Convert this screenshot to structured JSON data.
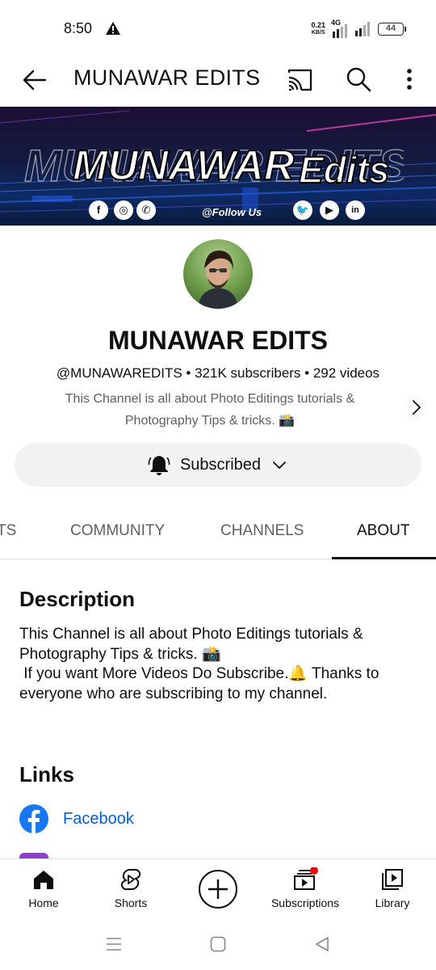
{
  "status_bar": {
    "time": "8:50",
    "net_speed_value": "0.21",
    "net_speed_unit": "KB/S",
    "network": "4G",
    "battery": "44"
  },
  "app_bar": {
    "title": "MUNAWAR EDITS"
  },
  "banner": {
    "follow_text": "@Follow Us"
  },
  "channel": {
    "name": "MUNAWAR EDITS",
    "meta": "@MUNAWAREDITS • 321K subscribers • 292 videos",
    "tagline": "This Channel is all about Photo Editings tutorials & Photography Tips & tricks. 📸"
  },
  "subscribe": {
    "label": "Subscribed"
  },
  "tabs": [
    {
      "label": "TS"
    },
    {
      "label": "COMMUNITY"
    },
    {
      "label": "CHANNELS"
    },
    {
      "label": "ABOUT",
      "active": true
    }
  ],
  "about": {
    "description_heading": "Description",
    "description_text": "This Channel is all about Photo Editings tutorials & Photography Tips & tricks. 📸\n If you want More Videos Do Subscribe.🔔 Thanks to everyone who are subscribing to my channel.",
    "links_heading": "Links",
    "links": [
      {
        "label": "Facebook",
        "icon": "facebook-icon"
      }
    ]
  },
  "bottom_nav": [
    {
      "label": "Home",
      "icon": "home-icon",
      "active": true
    },
    {
      "label": "Shorts",
      "icon": "shorts-icon"
    },
    {
      "label": "",
      "icon": "create-icon"
    },
    {
      "label": "Subscriptions",
      "icon": "subscriptions-icon",
      "badge": true
    },
    {
      "label": "Library",
      "icon": "library-icon"
    }
  ],
  "colors": {
    "link": "#065fd4",
    "notification_dot": "#ff0000",
    "button_bg": "#f2f2f2"
  }
}
